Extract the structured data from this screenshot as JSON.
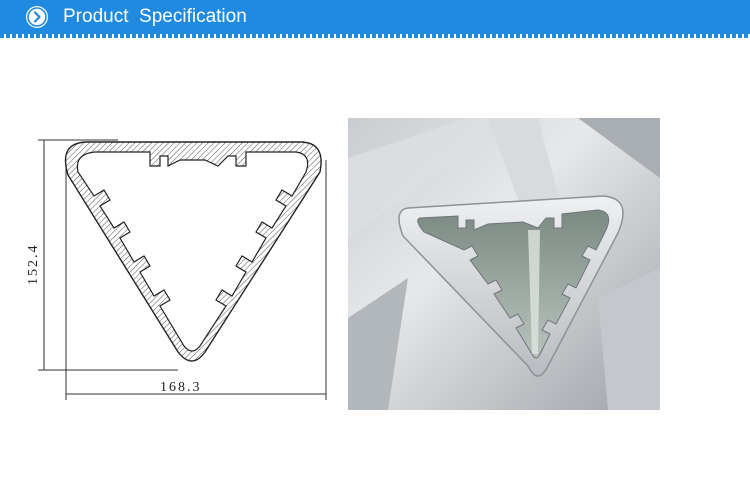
{
  "header": {
    "title": "Product  Specification",
    "icon": "chevron-right-circle-icon",
    "color": "#1f8ae0"
  },
  "drawing": {
    "height_label": "152.4",
    "width_label": "168.3"
  },
  "photo": {
    "description_icon": "aluminum-triangle-profile-photo"
  }
}
